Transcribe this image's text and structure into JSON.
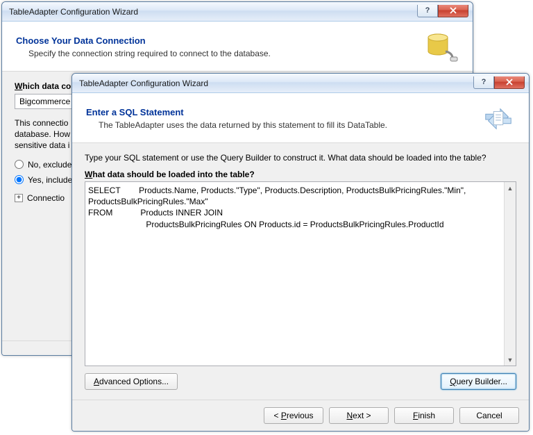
{
  "back_window": {
    "title": "TableAdapter Configuration Wizard",
    "header_title": "Choose Your Data Connection",
    "header_sub": "Specify the connection string required to connect to the database.",
    "section_label": "Which data co",
    "combo_value": "Bigcommerce",
    "para": "This connectio\ndatabase. How\nsensitive data i",
    "radio_no": "No, exclude",
    "radio_yes": "Yes, include",
    "expander_label": "Connectio"
  },
  "front_window": {
    "title": "TableAdapter Configuration Wizard",
    "header_title": "Enter a SQL Statement",
    "header_sub": "The TableAdapter uses the data returned by this statement to fill its DataTable.",
    "instruction": "Type your SQL statement or use the Query Builder to construct it. What data should be loaded into the table?",
    "sql_label": "What data should be loaded into the table?",
    "sql_text": "SELECT        Products.Name, Products.\"Type\", Products.Description, ProductsBulkPricingRules.\"Min\", ProductsBulkPricingRules.\"Max\"\nFROM            Products INNER JOIN\n                         ProductsBulkPricingRules ON Products.id = ProductsBulkPricingRules.ProductId",
    "advanced_label": "Advanced Options...",
    "query_builder_label": "Query Builder...",
    "buttons": {
      "previous": "< Previous",
      "next": "Next >",
      "finish": "Finish",
      "cancel": "Cancel"
    }
  }
}
